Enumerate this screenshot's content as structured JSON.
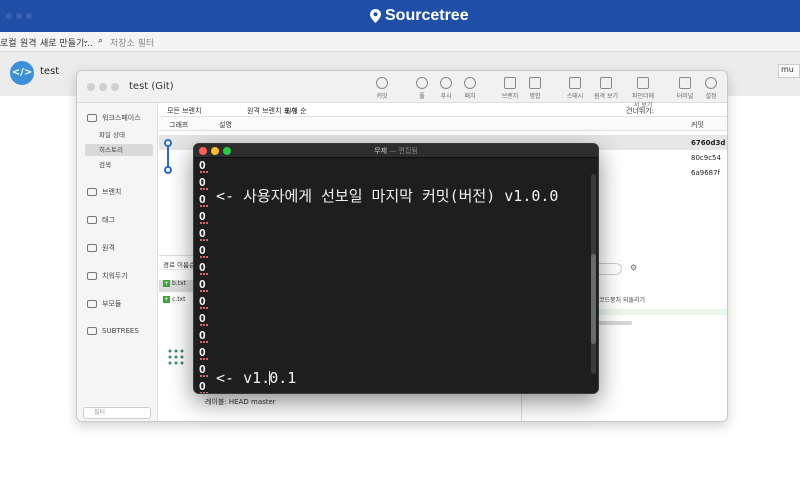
{
  "app": {
    "brand": "Sourcetree"
  },
  "toolbar2": {
    "local": "로컬",
    "remote": "원격",
    "new_menu": "새로 만들기...",
    "search_placeholder": "저장소 필터"
  },
  "repo_tab": {
    "name": "test",
    "right_chip": "mu"
  },
  "git_window": {
    "title": "test (Git)",
    "toolbar": [
      "커밋",
      "풀",
      "푸시",
      "패치",
      "브랜치",
      "병합",
      "스태시",
      "원격 보기",
      "파인더에서 보기",
      "터미널",
      "설정"
    ],
    "sidebar": {
      "workspace": "워크스페이스",
      "file_status": "파일 상태",
      "history": "히스토리",
      "search": "검색",
      "branches": "브랜치",
      "tags": "태그",
      "remotes": "원격",
      "stashes": "치워두기",
      "submodules": "부모듈",
      "subtrees": "SUBTREES",
      "filter": "필터"
    },
    "filters": {
      "all_branches": "모든 브랜치",
      "show_remote": "원격 브랜치 표시",
      "order": "원형 순",
      "jump_to": "건너뛰기:"
    },
    "columns": {
      "graph": "그래프",
      "description": "설명",
      "commit": "커밋"
    },
    "commits": [
      {
        "hash": "6760d3d"
      },
      {
        "hash": "80c9c54"
      },
      {
        "hash": "6a9687f"
      }
    ],
    "lower": {
      "path_sort": "경로 이름순",
      "files": [
        "b.txt",
        "c.txt"
      ],
      "label": "레이블: HEAD master",
      "search": "검색",
      "revert": "코드뭉치 되돌리기"
    }
  },
  "terminal": {
    "title": "무제",
    "subtitle": "— 편집됨",
    "line_top": "<- 사용자에게 선보일 마지막 커밋(버전) v1.0.0",
    "line_bottom_a": "<- v1.",
    "line_bottom_b": "0.1",
    "row_glyph": "O"
  },
  "colors": {
    "brand_blue": "#1f4fa6",
    "graph_blue": "#2f6bbf",
    "terminal_bg": "#1e1e1e"
  }
}
